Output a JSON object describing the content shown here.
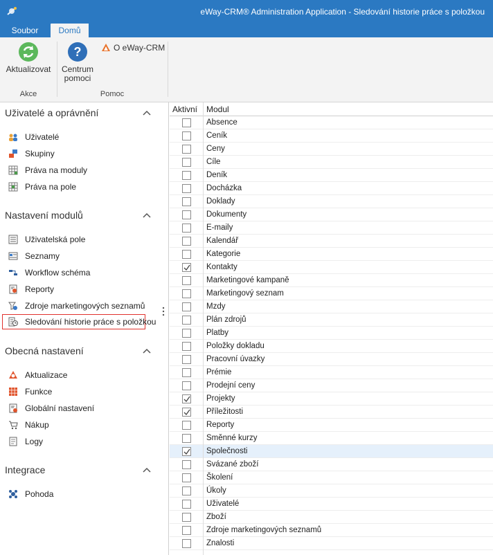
{
  "window": {
    "title": "eWay-CRM® Administration Application - Sledování historie práce s položkou"
  },
  "ribbon": {
    "tabs": [
      {
        "label": "Soubor",
        "active": false
      },
      {
        "label": "Domů",
        "active": true
      }
    ],
    "buttons": {
      "refresh": "Aktualizovat",
      "help_line1": "Centrum",
      "help_line2": "pomoci",
      "about": "O eWay-CRM"
    },
    "groups": {
      "actions": "Akce",
      "help": "Pomoc"
    }
  },
  "sidebar": {
    "sections": [
      {
        "title": "Uživatelé a oprávnění",
        "items": [
          {
            "label": "Uživatelé",
            "icon": "users-icon"
          },
          {
            "label": "Skupiny",
            "icon": "groups-icon"
          },
          {
            "label": "Práva na moduly",
            "icon": "module-rights-icon"
          },
          {
            "label": "Práva na pole",
            "icon": "field-rights-icon"
          }
        ]
      },
      {
        "title": "Nastavení modulů",
        "items": [
          {
            "label": "Uživatelská pole",
            "icon": "custom-fields-icon"
          },
          {
            "label": "Seznamy",
            "icon": "lists-icon"
          },
          {
            "label": "Workflow schéma",
            "icon": "workflow-icon"
          },
          {
            "label": "Reporty",
            "icon": "reports-icon"
          },
          {
            "label": "Zdroje marketingových seznamů",
            "icon": "marketing-sources-icon"
          },
          {
            "label": "Sledování historie práce s položkou",
            "icon": "history-tracking-icon",
            "selected": true
          }
        ]
      },
      {
        "title": "Obecná nastavení",
        "items": [
          {
            "label": "Aktualizace",
            "icon": "updates-icon"
          },
          {
            "label": "Funkce",
            "icon": "features-icon"
          },
          {
            "label": "Globální nastavení",
            "icon": "global-settings-icon"
          },
          {
            "label": "Nákup",
            "icon": "purchase-icon"
          },
          {
            "label": "Logy",
            "icon": "logs-icon"
          }
        ]
      },
      {
        "title": "Integrace",
        "items": [
          {
            "label": "Pohoda",
            "icon": "pohoda-icon"
          }
        ]
      }
    ]
  },
  "grid": {
    "columns": {
      "active": "Aktivní",
      "module": "Modul"
    },
    "rows": [
      {
        "module": "Absence",
        "active": false
      },
      {
        "module": "Ceník",
        "active": false
      },
      {
        "module": "Ceny",
        "active": false
      },
      {
        "module": "Cíle",
        "active": false
      },
      {
        "module": "Deník",
        "active": false
      },
      {
        "module": "Docházka",
        "active": false
      },
      {
        "module": "Doklady",
        "active": false
      },
      {
        "module": "Dokumenty",
        "active": false
      },
      {
        "module": "E-maily",
        "active": false
      },
      {
        "module": "Kalendář",
        "active": false
      },
      {
        "module": "Kategorie",
        "active": false
      },
      {
        "module": "Kontakty",
        "active": true
      },
      {
        "module": "Marketingové kampaně",
        "active": false
      },
      {
        "module": "Marketingový seznam",
        "active": false
      },
      {
        "module": "Mzdy",
        "active": false
      },
      {
        "module": "Plán zdrojů",
        "active": false
      },
      {
        "module": "Platby",
        "active": false
      },
      {
        "module": "Položky dokladu",
        "active": false
      },
      {
        "module": "Pracovní úvazky",
        "active": false
      },
      {
        "module": "Prémie",
        "active": false
      },
      {
        "module": "Prodejní ceny",
        "active": false
      },
      {
        "module": "Projekty",
        "active": true
      },
      {
        "module": "Příležitosti",
        "active": true
      },
      {
        "module": "Reporty",
        "active": false
      },
      {
        "module": "Směnné kurzy",
        "active": false
      },
      {
        "module": "Společnosti",
        "active": true,
        "selected": true
      },
      {
        "module": "Svázané zboží",
        "active": false
      },
      {
        "module": "Školení",
        "active": false
      },
      {
        "module": "Úkoly",
        "active": false
      },
      {
        "module": "Uživatelé",
        "active": false
      },
      {
        "module": "Zboží",
        "active": false
      },
      {
        "module": "Zdroje marketingových seznamů",
        "active": false
      },
      {
        "module": "Znalosti",
        "active": false
      }
    ]
  }
}
